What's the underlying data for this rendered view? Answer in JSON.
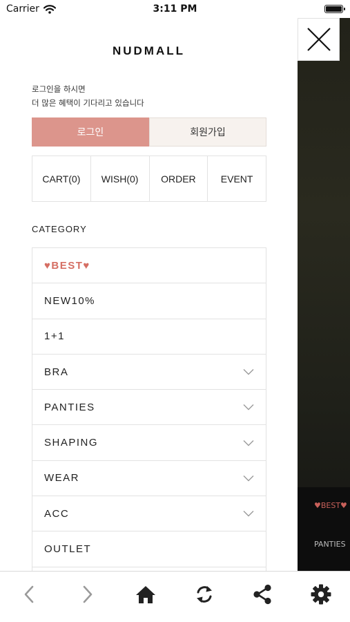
{
  "status_bar": {
    "carrier": "Carrier",
    "time": "3:11 PM"
  },
  "drawer": {
    "logo": "NUDMALL",
    "intro_line1": "로그인을 하시면",
    "intro_line2": "더 많은 혜택이 기다리고 있습니다",
    "login_label": "로그인",
    "join_label": "회원가입",
    "quick_links": [
      "CART(0)",
      "WISH(0)",
      "ORDER",
      "EVENT"
    ],
    "category_title": "CATEGORY",
    "categories": [
      {
        "label": "♥BEST♥",
        "expandable": false
      },
      {
        "label": "NEW10%",
        "expandable": false
      },
      {
        "label": "1+1",
        "expandable": false
      },
      {
        "label": "BRA",
        "expandable": true
      },
      {
        "label": "PANTIES",
        "expandable": true
      },
      {
        "label": "SHAPING",
        "expandable": true
      },
      {
        "label": "WEAR",
        "expandable": true
      },
      {
        "label": "ACC",
        "expandable": true
      },
      {
        "label": "OUTLET",
        "expandable": false
      }
    ]
  },
  "background_page": {
    "menu_best": "♥BEST♥",
    "menu_panties": "PANTIES"
  },
  "toolbar": {
    "icons": [
      "back-icon",
      "forward-icon",
      "home-icon",
      "refresh-icon",
      "share-icon",
      "settings-icon"
    ]
  },
  "colors": {
    "accent": "#dc958c",
    "best_text": "#d56e63",
    "join_bg": "#f7f2ee"
  }
}
